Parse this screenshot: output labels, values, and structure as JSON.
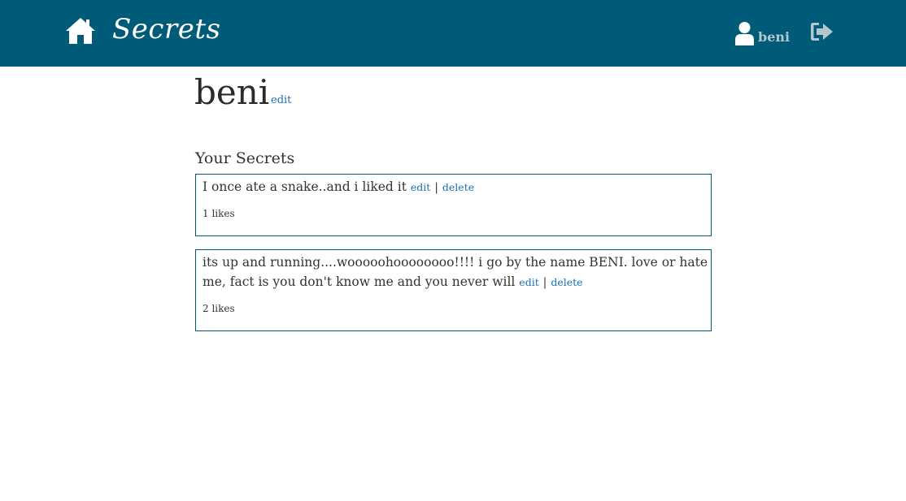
{
  "nav": {
    "brand": "Secrets",
    "home_icon": "home-icon",
    "user_icon": "user-icon",
    "user_name": "beni",
    "logout_icon": "sign-out-icon",
    "bg_color": "#005b79"
  },
  "profile": {
    "name": "beni",
    "edit_label": "edit"
  },
  "section": {
    "title": "Your Secrets"
  },
  "secrets": [
    {
      "text": "I once ate a snake..and i liked it",
      "edit_label": "edit",
      "separator": "|",
      "delete_label": "delete",
      "likes": "1 likes"
    },
    {
      "text": "its up and running....wooooohoooooooo!!!! i go by the name BENI. love or hate me, fact is you don't know me and you never will",
      "edit_label": "edit",
      "separator": "|",
      "delete_label": "delete",
      "likes": "2 likes"
    }
  ],
  "colors": {
    "link": "#1a6fb5",
    "border": "#005b79"
  }
}
